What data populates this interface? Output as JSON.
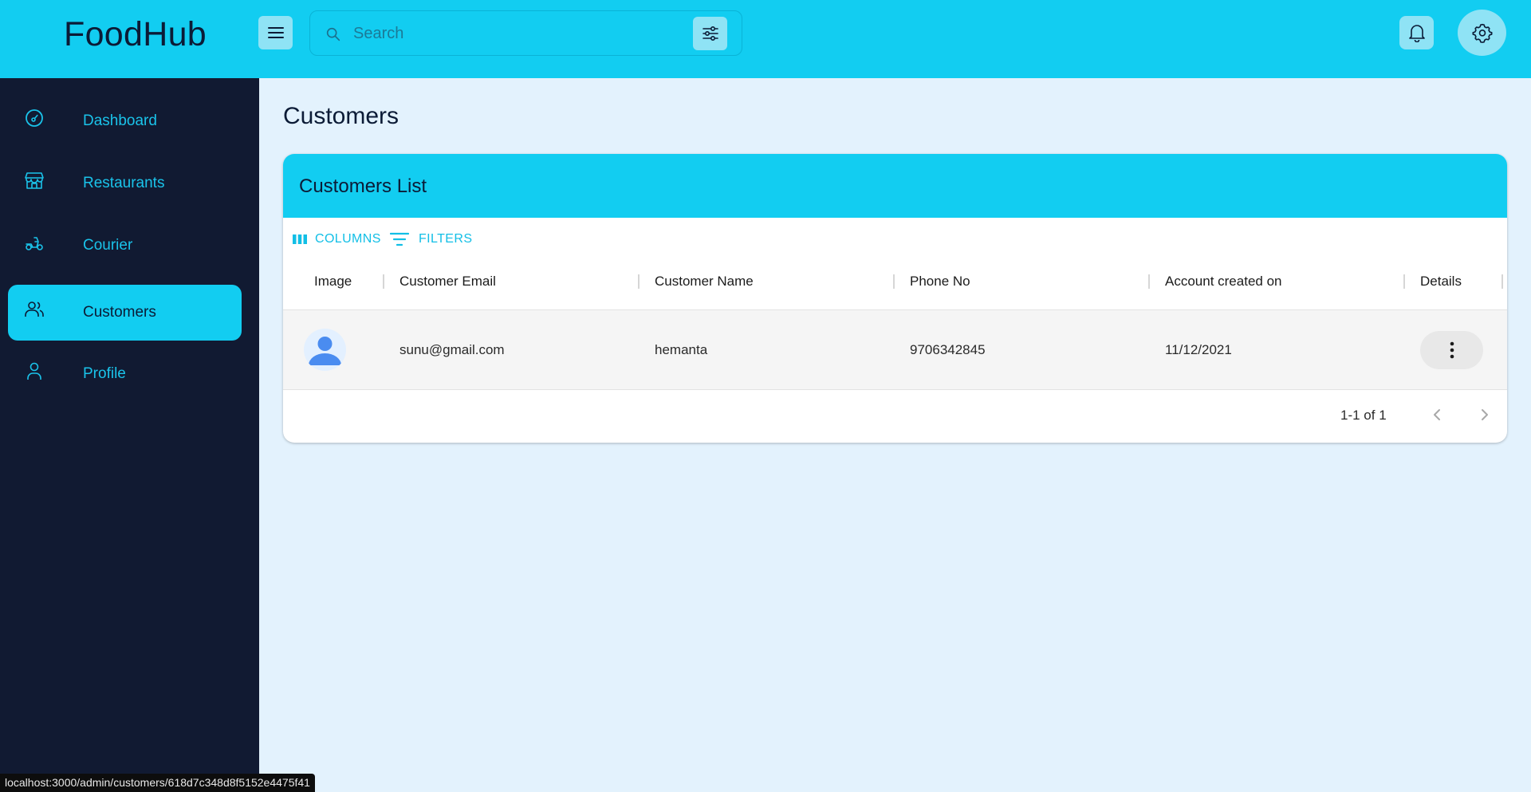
{
  "app": {
    "title": "FoodHub"
  },
  "header": {
    "search_placeholder": "Search",
    "menu_icon": "menu-icon",
    "filter_icon": "tune-icon",
    "notification_icon": "bell-icon",
    "settings_icon": "gear-icon"
  },
  "sidebar": {
    "items": [
      {
        "label": "Dashboard",
        "icon": "dashboard-icon",
        "active": false
      },
      {
        "label": "Restaurants",
        "icon": "store-icon",
        "active": false
      },
      {
        "label": "Courier",
        "icon": "scooter-icon",
        "active": false
      },
      {
        "label": "Customers",
        "icon": "users-icon",
        "active": true
      },
      {
        "label": "Profile",
        "icon": "user-icon",
        "active": false
      }
    ]
  },
  "main": {
    "page_title": "Customers",
    "card_title": "Customers List",
    "toolbar": {
      "columns_label": "COLUMNS",
      "filters_label": "FILTERS"
    },
    "columns": [
      "Image",
      "Customer Email",
      "Customer Name",
      "Phone No",
      "Account created on",
      "Details"
    ],
    "rows": [
      {
        "email": "sunu@gmail.com",
        "name": "hemanta",
        "phone": "9706342845",
        "created": "11/12/2021"
      }
    ],
    "pagination": {
      "text": "1-1 of 1"
    }
  },
  "status_bar": {
    "url": "localhost:3000/admin/customers/618d7c348d8f5152e4475f41"
  },
  "colors": {
    "accent": "#12cdf1",
    "sidebar_bg": "#111a32",
    "page_bg": "#e3f2fd"
  }
}
